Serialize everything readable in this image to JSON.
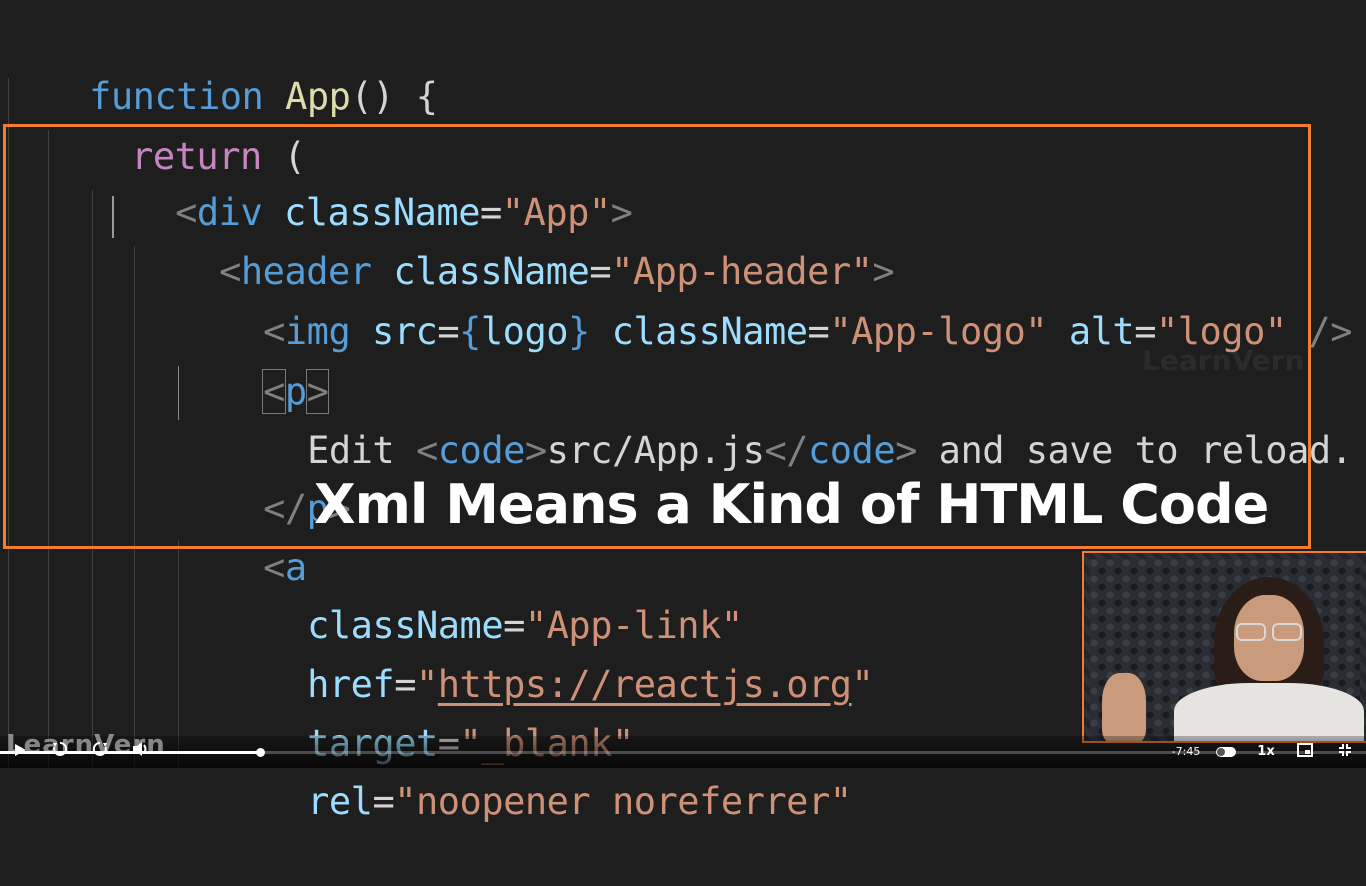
{
  "code": {
    "l1": {
      "kw": "function",
      "name": "App",
      "rest": "() {"
    },
    "l2": {
      "kw": "return",
      "rest": " ("
    },
    "l3": {
      "lt": "<",
      "tag": "div",
      "attr": "className",
      "eq": "=",
      "val": "\"App\"",
      "gt": ">"
    },
    "l4": {
      "lt": "<",
      "tag": "header",
      "attr": "className",
      "eq": "=",
      "val": "\"App-header\"",
      "gt": ">"
    },
    "l5": {
      "lt": "<",
      "tag": "img",
      "attr1": "src",
      "eq1": "=",
      "open": "{",
      "expr": "logo",
      "close": "}",
      "attr2": "className",
      "eq2": "=",
      "val2": "\"App-logo\"",
      "attr3": "alt",
      "eq3": "=",
      "val3": "\"logo\"",
      "end": "/>"
    },
    "l6": {
      "lt": "<",
      "tag": "p",
      "gt": ">"
    },
    "l7": {
      "text1": "Edit ",
      "lt1": "<",
      "tag1": "code",
      "gt1": ">",
      "inner": "src/App.js",
      "lt2": "</",
      "tag2": "code",
      "gt2": ">",
      "text2": " and save to reload."
    },
    "l8": {
      "lt": "</",
      "tag": "p",
      "gt": ">"
    },
    "l9": {
      "lt": "<",
      "tag": "a"
    },
    "l10": {
      "attr": "className",
      "eq": "=",
      "val": "\"App-link\""
    },
    "l11": {
      "attr": "href",
      "eq": "=",
      "q1": "\"",
      "url": "https://reactjs.org",
      "q2": "\""
    },
    "l12": {
      "attr": "target",
      "eq": "=",
      "val": "\"_blank\""
    },
    "l13": {
      "attr": "rel",
      "eq": "=",
      "val": "\"noopener noreferrer\""
    }
  },
  "caption": "Xml Means a Kind of HTML Code",
  "watermark": "LearnVern",
  "player": {
    "brand": "LearnVern",
    "time_remaining": "-7:45",
    "speed": "1x",
    "progress": 0.19,
    "icons": [
      "play-icon",
      "replay-icon",
      "forward-icon",
      "volume-icon",
      "autoplay-toggle",
      "pip-icon",
      "fullscreen-exit-icon"
    ]
  },
  "colors": {
    "highlight": "#f47c2c",
    "keyword": "#569cd6",
    "control": "#c586c0",
    "string": "#ce9178",
    "attribute": "#9cdcfe",
    "function": "#dcdcaa"
  }
}
